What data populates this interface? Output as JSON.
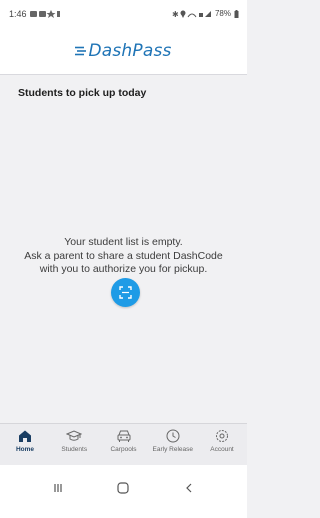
{
  "status_bar": {
    "time": "1:46",
    "battery": "78%"
  },
  "header": {
    "logo_text": "DashPass"
  },
  "main": {
    "section_title": "Students to pick up today",
    "empty_lines": [
      "Your student list is empty.",
      "Ask a parent to share a student DashCode",
      "with you to authorize you for pickup."
    ]
  },
  "tabs": [
    {
      "label": "Home",
      "icon": "home-icon",
      "active": true
    },
    {
      "label": "Students",
      "icon": "graduation-cap-icon",
      "active": false
    },
    {
      "label": "Carpools",
      "icon": "car-icon",
      "active": false
    },
    {
      "label": "Early Release",
      "icon": "clock-icon",
      "active": false
    },
    {
      "label": "Account",
      "icon": "gear-icon",
      "active": false
    }
  ],
  "colors": {
    "accent": "#1e9be6",
    "brand": "#1f74b6",
    "active_tab": "#1a3e63"
  }
}
